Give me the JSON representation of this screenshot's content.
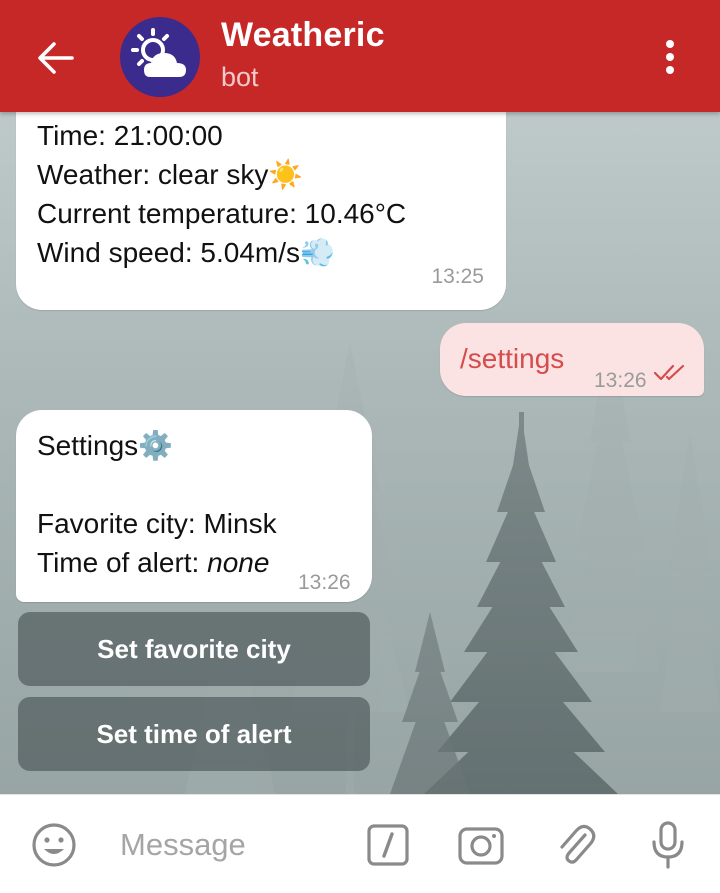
{
  "header": {
    "title": "Weatheric",
    "subtitle": "bot",
    "avatar_icon": "sun-cloud-icon",
    "colors": {
      "bar": "#c62828",
      "avatar": "#3b2b8c"
    }
  },
  "messages": [
    {
      "from": "bot",
      "lines": [
        "Time: 21:00:00",
        "Weather: clear sky",
        "Current temperature: 10.46°C",
        "Wind speed: 5.04m/s"
      ],
      "emoji": {
        "weather": "☀️",
        "wind": "💨"
      },
      "time": "13:25"
    },
    {
      "from": "user",
      "text": "/settings",
      "time": "13:26",
      "status": "read"
    },
    {
      "from": "bot",
      "title": "Settings",
      "title_emoji": "⚙️",
      "favorite_city_label": "Favorite city: ",
      "favorite_city_value": "Minsk",
      "alert_label": "Time of alert: ",
      "alert_value": "none",
      "time": "13:26"
    }
  ],
  "keyboard": [
    {
      "label": "Set favorite city"
    },
    {
      "label": "Set time of alert"
    }
  ],
  "input": {
    "placeholder": "Message",
    "icons": [
      "emoji-icon",
      "bot-command-icon",
      "camera-icon",
      "attach-icon",
      "mic-icon"
    ]
  }
}
